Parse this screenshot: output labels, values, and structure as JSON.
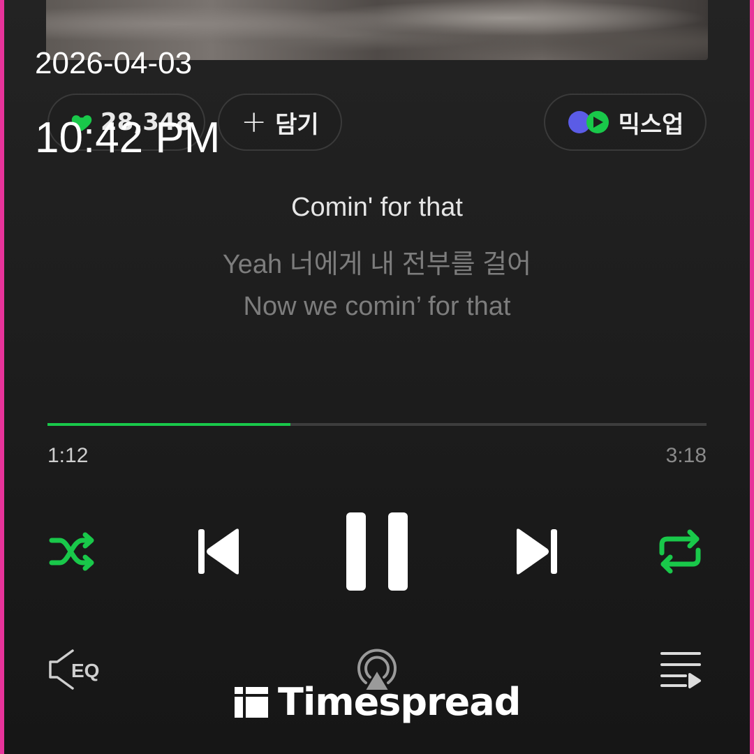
{
  "overlay": {
    "date": "2026-04-03",
    "time": "10:42 PM"
  },
  "actions": {
    "like_count": "28,348",
    "add_label": "담기",
    "mixup_label": "믹스업"
  },
  "lyrics": [
    "Comin' for that",
    "Yeah 너에게 내 전부를 걸어",
    "Now we comin’ for that"
  ],
  "progress": {
    "elapsed": "1:12",
    "total": "3:18",
    "fraction": 0.3684
  },
  "controls": {
    "shuffle_icon": "shuffle-icon",
    "prev_icon": "skip-previous-icon",
    "pause_icon": "pause-icon",
    "next_icon": "skip-next-icon",
    "repeat_icon": "repeat-icon",
    "eq_label": "EQ",
    "cast_icon": "airplay-icon",
    "playlist_icon": "playlist-icon"
  },
  "colors": {
    "accent": "#19c84a",
    "frame": "#e8339a",
    "background": "#1e1e1e"
  },
  "watermark": {
    "brand": "Timespread"
  }
}
